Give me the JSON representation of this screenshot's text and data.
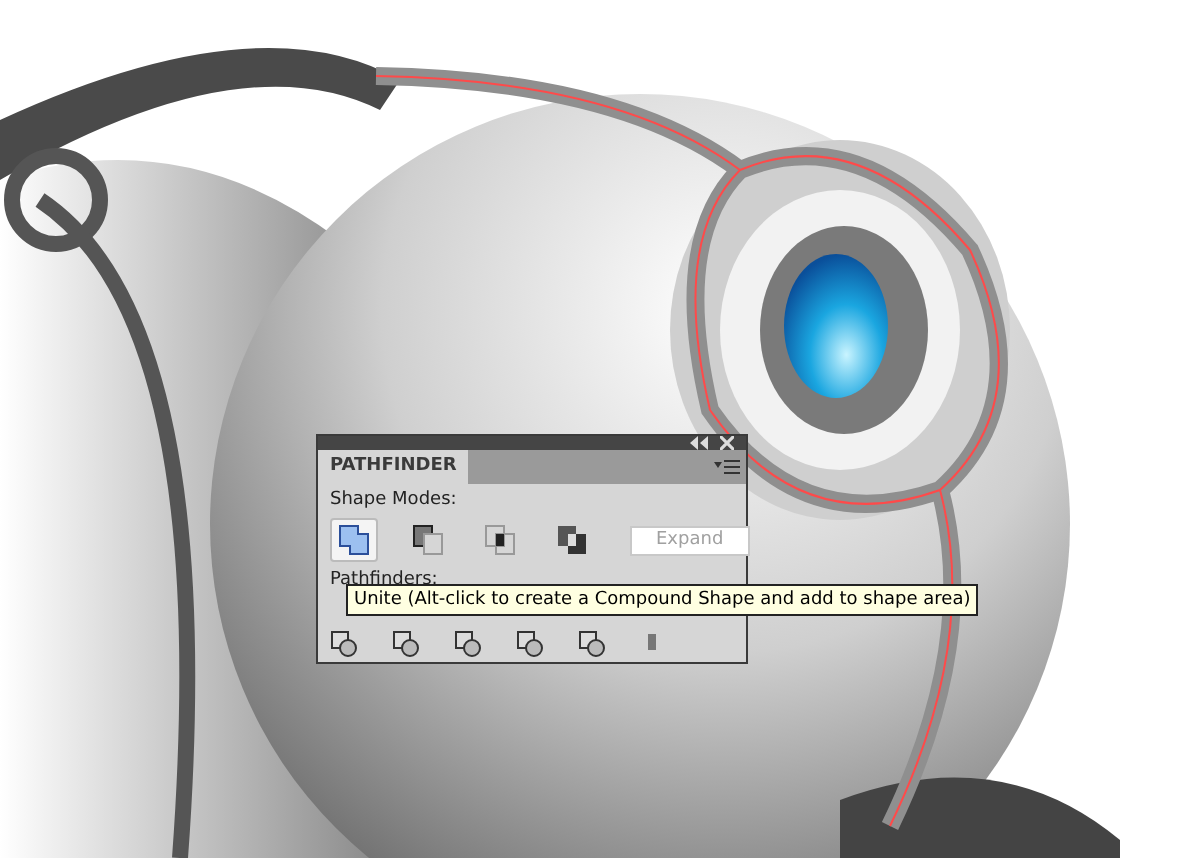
{
  "panel": {
    "tab": "PATHFINDER",
    "shape_modes": {
      "label": "Shape Modes:",
      "buttons": [
        {
          "kind": "unite",
          "selected": true
        },
        {
          "kind": "minus-front",
          "selected": false
        },
        {
          "kind": "intersect",
          "selected": false
        },
        {
          "kind": "exclude",
          "selected": false
        }
      ],
      "expand": {
        "label": "Expand",
        "disabled": true
      }
    },
    "pathfinders": {
      "label": "Pathfinders:",
      "buttons": [
        {
          "kind": "divide"
        },
        {
          "kind": "trim"
        },
        {
          "kind": "merge"
        },
        {
          "kind": "crop"
        },
        {
          "kind": "outline"
        },
        {
          "kind": "minus-back"
        }
      ]
    },
    "tooltip": "Unite (Alt-click to create a Compound Shape and add to shape area)"
  }
}
